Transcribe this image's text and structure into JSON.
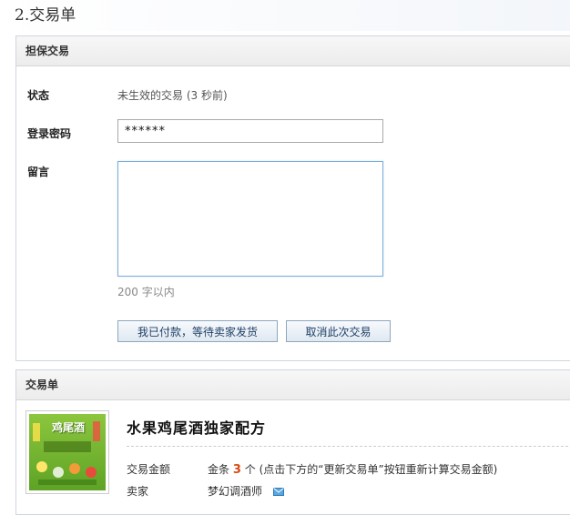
{
  "page_title": "2.交易单",
  "escrow": {
    "header": "担保交易",
    "status_label": "状态",
    "status_value": "未生效的交易 (3 秒前)",
    "password_label": "登录密码",
    "password_value": "******",
    "message_label": "留言",
    "message_value": "",
    "message_hint": "200 字以内",
    "paid_button": "我已付款，等待卖家发货",
    "cancel_button": "取消此次交易"
  },
  "order": {
    "header": "交易单",
    "product_title": "水果鸡尾酒独家配方",
    "cover_text": "鸡尾酒",
    "amount_label": "交易金额",
    "amount_prefix": "金条",
    "amount_value": "3",
    "amount_unit": "个",
    "amount_note": "(点击下方的“更新交易单”按钮重新计算交易金额)",
    "seller_label": "卖家",
    "seller_name": "梦幻调酒师"
  },
  "colors": {
    "amount_highlight": "#d94b14",
    "button_text": "#1f3f66",
    "input_focus_border": "#7aaed9"
  }
}
